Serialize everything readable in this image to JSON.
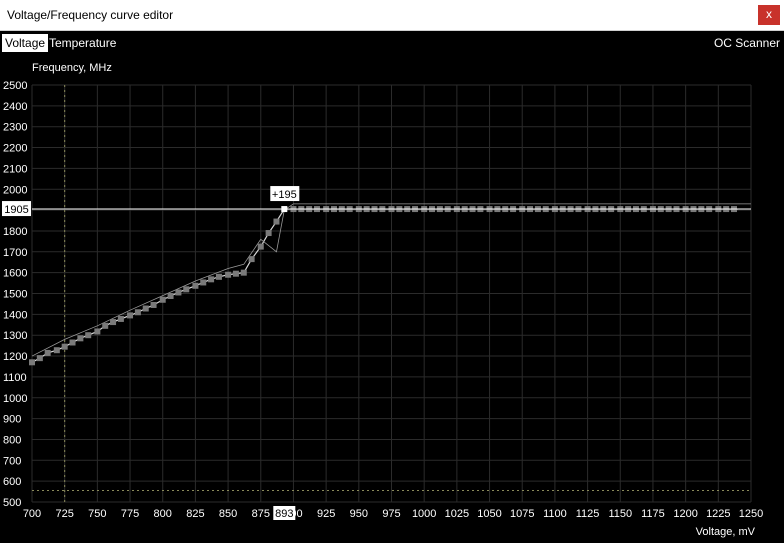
{
  "window": {
    "title": "Voltage/Frequency curve editor",
    "close_label": "x"
  },
  "tabs": [
    {
      "label": "Voltage",
      "active": true
    },
    {
      "label": "Temperature",
      "active": false
    }
  ],
  "oc_scanner_label": "OC Scanner",
  "colors": {
    "background": "#000000",
    "grid": "#2b2b2b",
    "curve": "#d8d8d8",
    "point": "#7a7a7a",
    "selected_point": "#ffffff"
  },
  "chart_data": {
    "type": "line",
    "ylabel": "Frequency, MHz",
    "xlabel": "Voltage, mV",
    "xlim": [
      700,
      1250
    ],
    "ylim": [
      500,
      2500
    ],
    "x_ticks": [
      700,
      725,
      750,
      775,
      800,
      825,
      850,
      875,
      900,
      925,
      950,
      975,
      1000,
      1025,
      1050,
      1075,
      1100,
      1125,
      1150,
      1175,
      1200,
      1225,
      1250
    ],
    "y_ticks": [
      500,
      600,
      700,
      800,
      900,
      1000,
      1100,
      1200,
      1300,
      1400,
      1500,
      1600,
      1700,
      1800,
      1900,
      2000,
      2100,
      2200,
      2300,
      2400,
      2500
    ],
    "selected": {
      "voltage": 893,
      "voltage_label": "893",
      "frequency": 1905,
      "frequency_label": "1905",
      "offset_label": "+195"
    },
    "series": [
      {
        "role": "curve",
        "x": [
          700,
          706,
          712,
          719,
          725,
          731,
          737,
          743,
          750,
          756,
          762,
          768,
          775,
          781,
          787,
          793,
          800,
          806,
          812,
          818,
          825,
          831,
          837,
          843,
          850,
          856,
          862,
          868,
          875,
          881,
          887,
          893,
          900,
          1240
        ],
        "y": [
          1170,
          1190,
          1215,
          1228,
          1245,
          1265,
          1285,
          1300,
          1318,
          1345,
          1363,
          1378,
          1395,
          1410,
          1428,
          1445,
          1470,
          1488,
          1505,
          1520,
          1537,
          1553,
          1568,
          1580,
          1590,
          1595,
          1600,
          1665,
          1725,
          1790,
          1845,
          1905,
          1905,
          1905
        ]
      },
      {
        "role": "default_curve",
        "x": [
          700,
          725,
          750,
          775,
          800,
          825,
          850,
          862,
          875,
          887,
          893,
          900,
          1250
        ],
        "y": [
          1200,
          1280,
          1345,
          1420,
          1490,
          1560,
          1620,
          1640,
          1760,
          1700,
          1900,
          1930,
          1930
        ]
      },
      {
        "role": "points",
        "x": [
          700,
          706,
          712,
          719,
          725,
          731,
          737,
          743,
          750,
          756,
          762,
          768,
          775,
          781,
          787,
          793,
          800,
          806,
          812,
          818,
          825,
          831,
          837,
          843,
          850,
          856,
          862,
          868,
          875,
          881,
          887,
          893,
          900,
          906,
          912,
          918,
          925,
          931,
          937,
          943,
          950,
          956,
          962,
          968,
          975,
          981,
          987,
          993,
          1000,
          1006,
          1012,
          1018,
          1025,
          1031,
          1037,
          1043,
          1050,
          1056,
          1062,
          1068,
          1075,
          1081,
          1087,
          1093,
          1100,
          1106,
          1112,
          1118,
          1125,
          1131,
          1137,
          1143,
          1150,
          1156,
          1162,
          1168,
          1175,
          1181,
          1187,
          1193,
          1200,
          1206,
          1212,
          1218,
          1225,
          1231,
          1237
        ],
        "y": [
          1170,
          1190,
          1215,
          1228,
          1245,
          1265,
          1285,
          1300,
          1318,
          1345,
          1363,
          1378,
          1395,
          1410,
          1428,
          1445,
          1470,
          1488,
          1505,
          1520,
          1537,
          1553,
          1568,
          1580,
          1590,
          1595,
          1600,
          1665,
          1725,
          1790,
          1845,
          1905,
          1905,
          1905,
          1905,
          1905,
          1905,
          1905,
          1905,
          1905,
          1905,
          1905,
          1905,
          1905,
          1905,
          1905,
          1905,
          1905,
          1905,
          1905,
          1905,
          1905,
          1905,
          1905,
          1905,
          1905,
          1905,
          1905,
          1905,
          1905,
          1905,
          1905,
          1905,
          1905,
          1905,
          1905,
          1905,
          1905,
          1905,
          1905,
          1905,
          1905,
          1905,
          1905,
          1905,
          1905,
          1905,
          1905,
          1905,
          1905,
          1905,
          1905,
          1905,
          1905,
          1905,
          1905,
          1905
        ]
      }
    ],
    "markers": {
      "vertical_dashed_at_voltage": 725,
      "horizontal_dashed_at_frequency": 555
    }
  }
}
